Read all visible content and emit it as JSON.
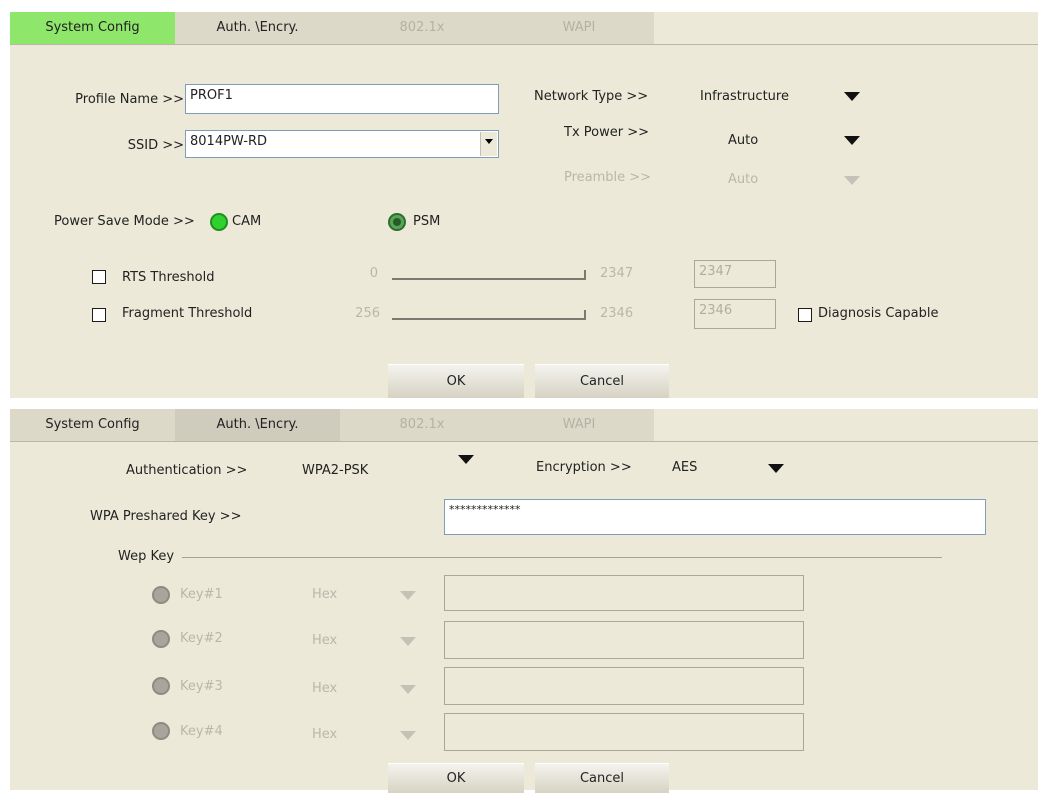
{
  "tabs": [
    {
      "label": "System Config"
    },
    {
      "label": "Auth. \\Encry."
    },
    {
      "label": "802.1x"
    },
    {
      "label": "WAPI"
    }
  ],
  "system_config": {
    "profile_name_label": "Profile Name >>",
    "profile_name_value": "PROF1",
    "ssid_label": "SSID >>",
    "ssid_value": "8014PW-RD",
    "network_type_label": "Network Type >>",
    "network_type_value": "Infrastructure",
    "tx_power_label": "Tx Power >>",
    "tx_power_value": "Auto",
    "preamble_label": "Preamble >>",
    "preamble_value": "Auto",
    "power_save_label": "Power Save Mode >>",
    "cam_label": "CAM",
    "psm_label": "PSM",
    "rts_label": "RTS Threshold",
    "rts_min": "0",
    "rts_max": "2347",
    "rts_value": "2347",
    "frag_label": "Fragment Threshold",
    "frag_min": "256",
    "frag_max": "2346",
    "frag_value": "2346",
    "diagnosis_label": "Diagnosis Capable",
    "ok_label": "OK",
    "cancel_label": "Cancel"
  },
  "auth_encry": {
    "authentication_label": "Authentication >>",
    "authentication_value": "WPA2-PSK",
    "encryption_label": "Encryption >>",
    "encryption_value": "AES",
    "wpa_key_label": "WPA Preshared Key >>",
    "wpa_key_value": "*************",
    "wep_key_group_label": "Wep Key",
    "keys": [
      {
        "label": "Key#1",
        "format": "Hex"
      },
      {
        "label": "Key#2",
        "format": "Hex"
      },
      {
        "label": "Key#3",
        "format": "Hex"
      },
      {
        "label": "Key#4",
        "format": "Hex"
      }
    ],
    "ok_label": "OK",
    "cancel_label": "Cancel"
  },
  "colors": {
    "panel_bg": "#ece9d8",
    "active_tab_green": "#8ee66a",
    "radio_green": "#2fd12f"
  }
}
